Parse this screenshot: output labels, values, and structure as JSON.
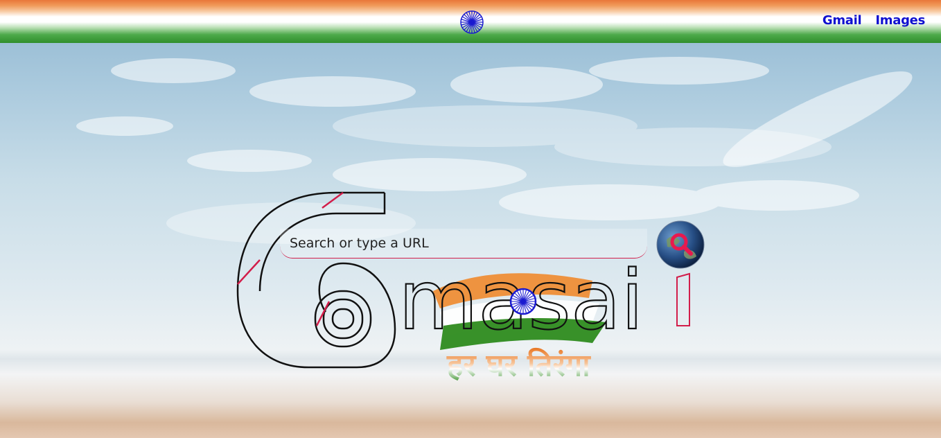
{
  "header": {
    "emblem_icon": "ashoka-chakra-icon",
    "links": [
      {
        "label": "Gmail"
      },
      {
        "label": "Images"
      }
    ]
  },
  "logo": {
    "wordmark": "masai",
    "tagline": "हर घर तिरंगा"
  },
  "search": {
    "placeholder": "Search or type a URL",
    "value": "",
    "button_icon": "globe-search-icon"
  },
  "colors": {
    "saffron": "#e8773a",
    "green": "#2f8f2c",
    "link": "#1010d0",
    "accent_red": "#d21d4a",
    "chakra_blue": "#1a1ad0"
  }
}
